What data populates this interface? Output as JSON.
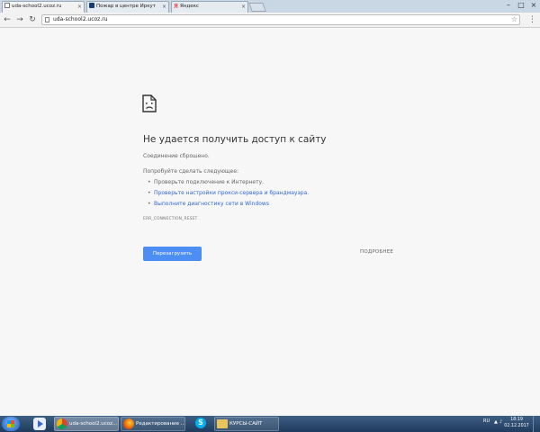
{
  "browser": {
    "tabs": [
      {
        "label": "uda-school2.ucoz.ru",
        "active": true
      },
      {
        "label": "Пожар в центре Иркут"
      },
      {
        "label": "Яндекс"
      }
    ],
    "url": "uda-school2.ucoz.ru"
  },
  "error": {
    "title": "Не удается получить доступ к сайту",
    "subtitle": "Соединение сброшено.",
    "try_heading": "Попробуйте сделать следующее:",
    "suggestions": [
      {
        "text": "Проверьте подключение к Интернету.",
        "link": false
      },
      {
        "text": "Проверьте настройки прокси-сервера и брандмауэра.",
        "link": true
      },
      {
        "text": "Выполните диагностику сети в Windows",
        "link": true
      }
    ],
    "code": "ERR_CONNECTION_RESET",
    "reload_label": "Перезагрузить",
    "details_label": "ПОДРОБНЕЕ"
  },
  "taskbar": {
    "items": [
      {
        "label": "uda-school2.ucoz...",
        "icon": "chrome-icon",
        "active": true
      },
      {
        "label": "Редактирование ...",
        "icon": "firefox-icon"
      },
      {
        "label": "",
        "icon": "skype-icon"
      },
      {
        "label": "КУРСЫ-САЙТ",
        "icon": "folder-icon"
      }
    ],
    "language": "RU",
    "time": "18:19",
    "date": "02.12.2017"
  },
  "colors": {
    "accent_button": "#4c8ef3",
    "link": "#3367d6",
    "page_bg": "#f7f7f7"
  }
}
